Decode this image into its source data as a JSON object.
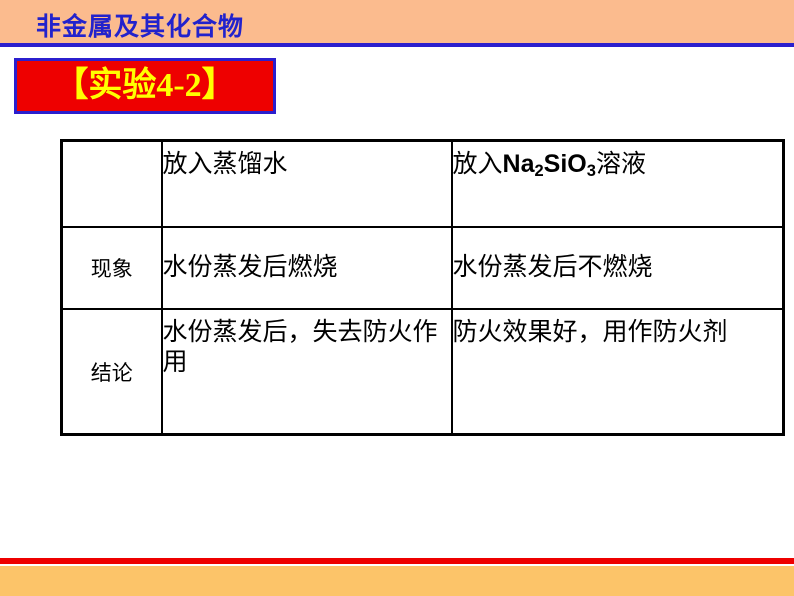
{
  "header": {
    "title": "非金属及其化合物",
    "band_color": "#FBBB8E",
    "rule_color": "#2B1FCE",
    "title_color": "#2222CC"
  },
  "experiment_box": {
    "label": "【实验4-2】",
    "fill_color": "#EE0000",
    "border_color": "#2B1FCE",
    "text_color": "#FFFF00"
  },
  "table": {
    "header_row": {
      "corner": "",
      "col1": "放入蒸馏水",
      "col2_prefix": "放入",
      "col2_formula_na": "Na",
      "col2_formula_na_sub": "2",
      "col2_formula_sio": "SiO",
      "col2_formula_sio_sub": "3",
      "col2_suffix": "溶液",
      "col2_plain": "放入Na2SiO3溶液"
    },
    "rows": [
      {
        "label": "现象",
        "col1": "水份蒸发后燃烧",
        "col2": "水份蒸发后不燃烧"
      },
      {
        "label": "结论",
        "col1": "水份蒸发后，失去防火作用",
        "col2": "防火效果好，用作防火剂"
      }
    ]
  },
  "footer": {
    "rule_color": "#EE0000",
    "band_color": "#FCC469"
  }
}
